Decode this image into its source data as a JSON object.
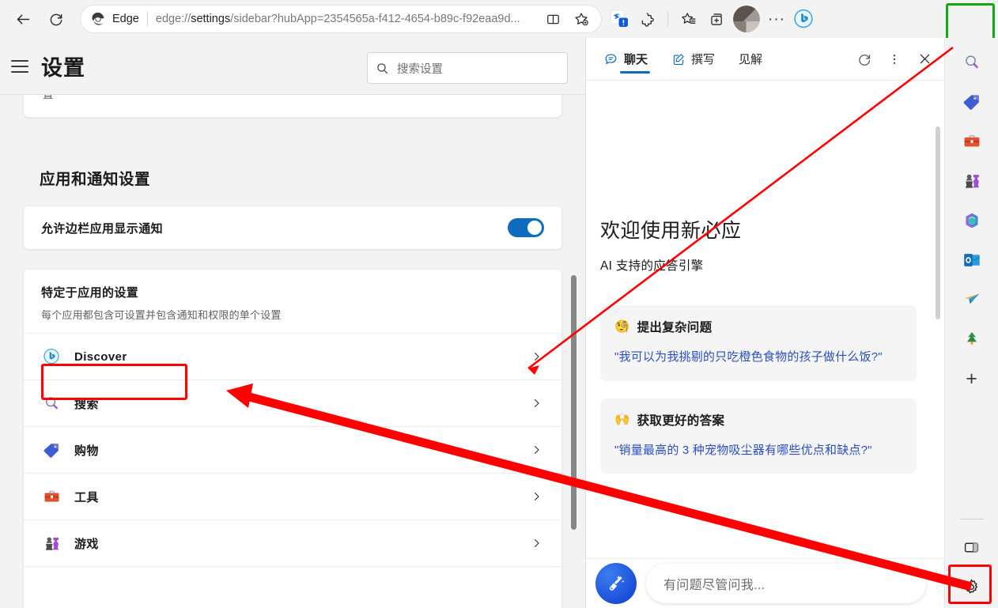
{
  "browser": {
    "back_tooltip": "后退",
    "reload_tooltip": "刷新",
    "brand": "Edge",
    "url_prefix": "edge://",
    "url_bold": "settings",
    "url_suffix": "/sidebar?hubApp=2354565a-f412-4654-b89c-f92eaa9d...",
    "toolbar_icons": [
      "split-screen-icon",
      "add-favorite-icon",
      "downloads-alert-icon",
      "extensions-icon",
      "collections-icon",
      "add-tab-group-icon",
      "profile-avatar",
      "more-options-icon",
      "copilot-bing-icon"
    ],
    "more_glyph": "···"
  },
  "settings": {
    "menu_label": "菜单",
    "title": "设置",
    "search_placeholder": "搜索设置",
    "partial_card_text": "置",
    "section_title": "应用和通知设置",
    "notification_toggle": {
      "label": "允许边栏应用显示通知",
      "state": "on"
    },
    "apps_card": {
      "title": "特定于应用的设置",
      "subtitle": "每个应用都包含可设置并包含通知和权限的单个设置",
      "rows": [
        {
          "icon": "bing-discover-icon",
          "label": "Discover",
          "highlighted": true
        },
        {
          "icon": "search-icon",
          "label": "搜索",
          "highlighted": false
        },
        {
          "icon": "shopping-tag-icon",
          "label": "购物",
          "highlighted": false
        },
        {
          "icon": "tools-briefcase-icon",
          "label": "工具",
          "highlighted": false
        },
        {
          "icon": "games-icon",
          "label": "游戏",
          "highlighted": false
        }
      ]
    }
  },
  "copilot": {
    "tabs": [
      {
        "label": "聊天",
        "icon": "chat-bubble-icon",
        "active": true
      },
      {
        "label": "撰写",
        "icon": "compose-pencil-icon",
        "active": false
      },
      {
        "label": "见解",
        "icon": "",
        "active": false
      }
    ],
    "actions": [
      "refresh-icon",
      "more-options-icon",
      "close-icon"
    ],
    "welcome_title": "欢迎使用新必应",
    "welcome_subtitle": "AI 支持的应答引擎",
    "suggestions": [
      {
        "emoji": "🧐",
        "emoji_name": "monocle-face-icon",
        "title": "提出复杂问题",
        "question": "\"我可以为我挑剔的只吃橙色食物的孩子做什么饭?\""
      },
      {
        "emoji": "🙌",
        "emoji_name": "raising-hands-icon",
        "title": "获取更好的答案",
        "question": "\"销量最高的 3 种宠物吸尘器有哪些优点和缺点?\""
      }
    ],
    "new_topic_label": "新主题",
    "input_placeholder": "有问题尽管问我..."
  },
  "sidebar": {
    "items": [
      {
        "name": "copilot-bing-icon",
        "label": "必应",
        "highlighted": true
      },
      {
        "name": "search-icon",
        "label": "搜索"
      },
      {
        "name": "shopping-tag-icon",
        "label": "购物"
      },
      {
        "name": "tools-briefcase-icon",
        "label": "工具"
      },
      {
        "name": "games-icon",
        "label": "游戏"
      },
      {
        "name": "microsoft365-icon",
        "label": "Microsoft 365"
      },
      {
        "name": "outlook-icon",
        "label": "Outlook"
      },
      {
        "name": "paper-plane-icon",
        "label": "发送"
      },
      {
        "name": "tree-icon",
        "label": "树"
      },
      {
        "name": "add-icon",
        "label": "+"
      }
    ],
    "bottom": [
      {
        "name": "panel-toggle-icon",
        "label": "切换边栏"
      },
      {
        "name": "settings-gear-icon",
        "label": "设置",
        "highlighted": true
      }
    ]
  },
  "annotations": {
    "highlight_green": "#17a81a",
    "highlight_red": "#ff0000",
    "arrow_color": "#ff0000"
  }
}
